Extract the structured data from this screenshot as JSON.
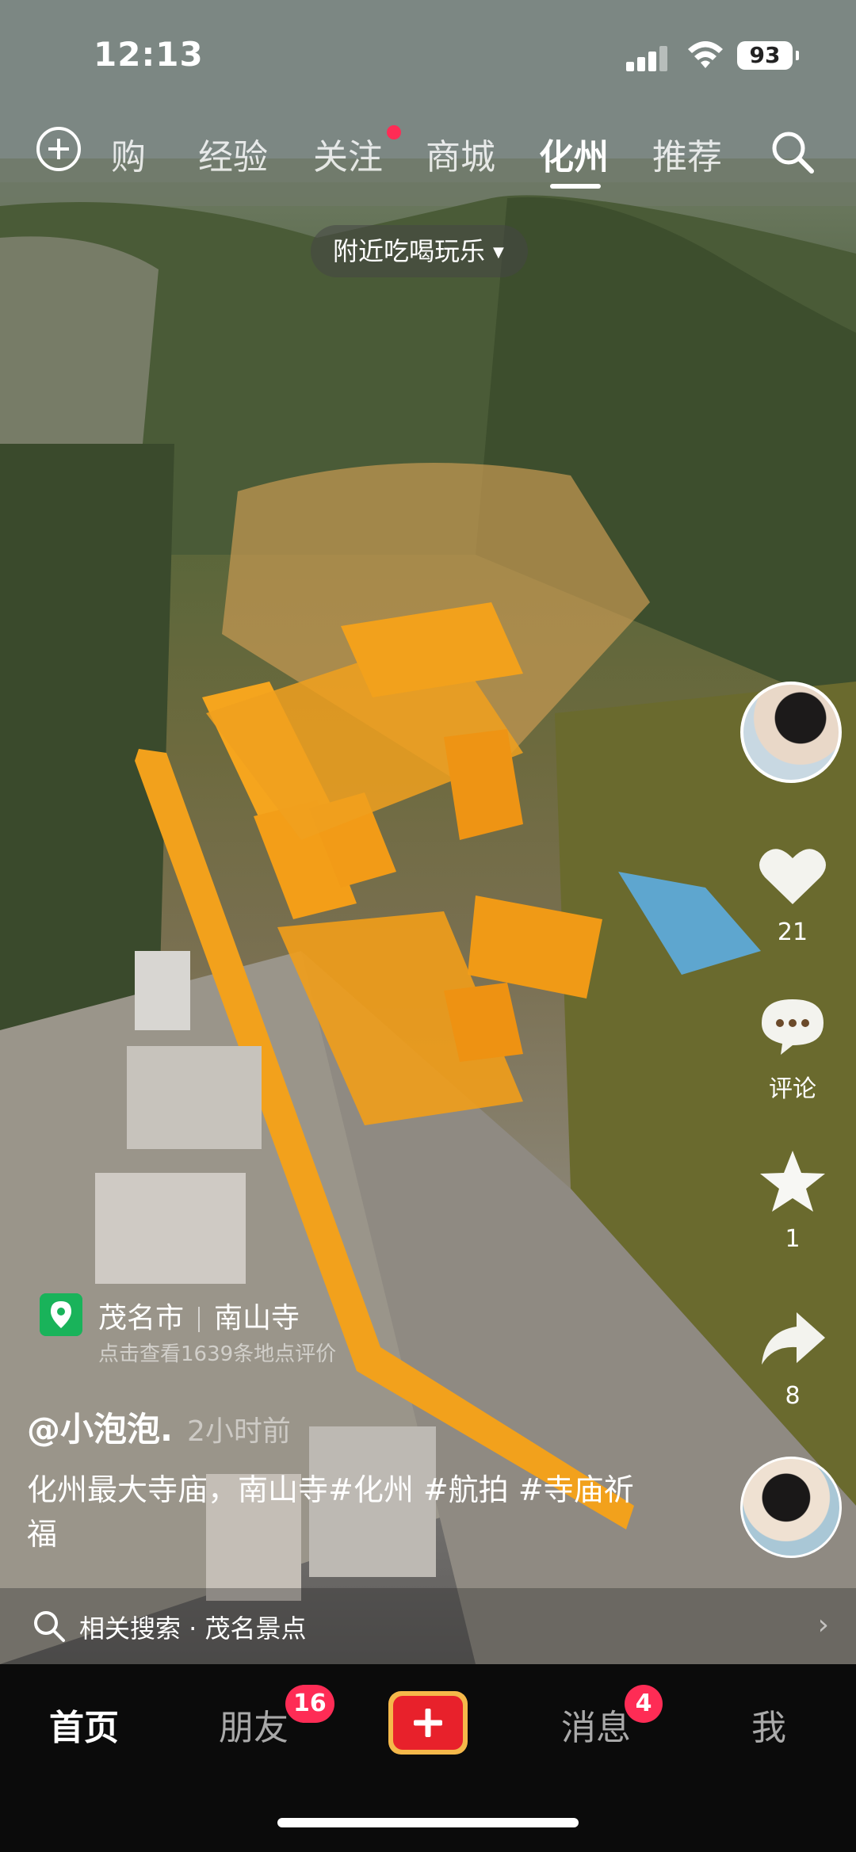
{
  "status_bar": {
    "time": "12:13",
    "battery": "93"
  },
  "top_nav": {
    "tabs": [
      {
        "label": "购"
      },
      {
        "label": "经验"
      },
      {
        "label": "关注"
      },
      {
        "label": "商城"
      },
      {
        "label": "化州"
      },
      {
        "label": "推荐"
      }
    ],
    "active_tab": "化州",
    "nearby_label": "附近吃喝玩乐"
  },
  "video": {
    "likes": "21",
    "comment_label": "评论",
    "favorites": "1",
    "shares": "8",
    "location": {
      "city": "茂名市",
      "place": "南山寺",
      "subtitle": "点击查看1639条地点评价"
    },
    "author": "@小泡泡.",
    "posted": "2小时前",
    "caption": "化州最大寺庙，南山寺#化州 #航拍 #寺庙祈福",
    "related_search": "相关搜索 · 茂名景点"
  },
  "bottom_nav": {
    "home": "首页",
    "friends": "朋友",
    "friends_badge": "16",
    "messages": "消息",
    "messages_badge": "4",
    "me": "我"
  },
  "colors": {
    "accent": "#fe2c55",
    "roof": "#f2a11c",
    "location_green": "#19b35a"
  }
}
